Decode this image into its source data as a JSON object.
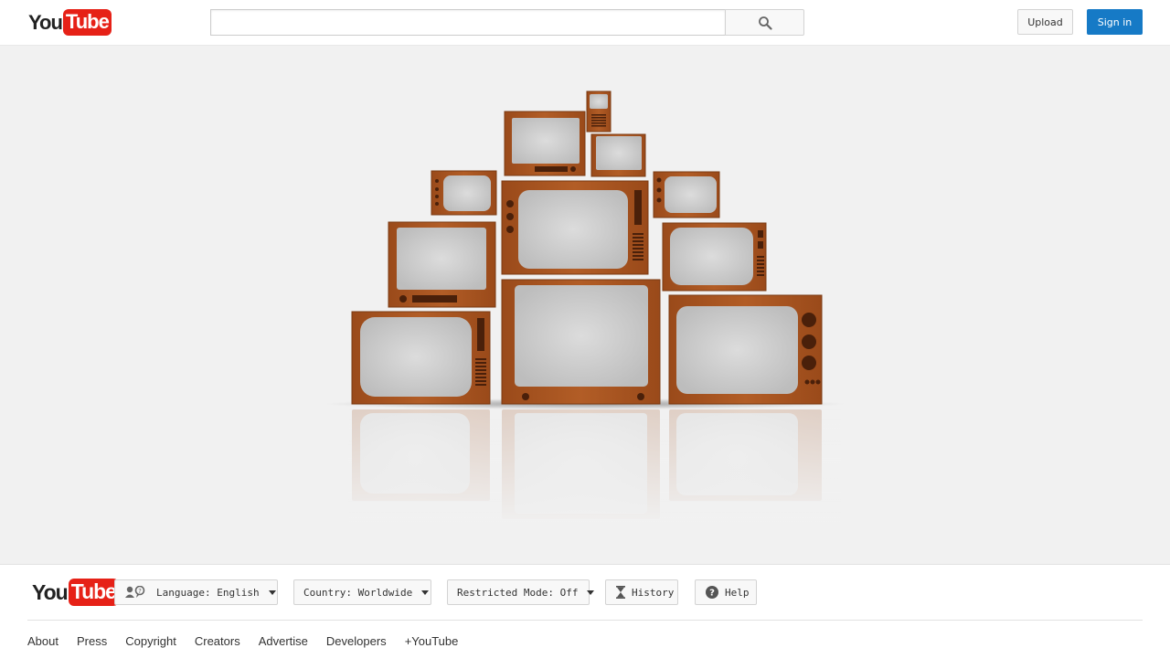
{
  "header": {
    "logo": {
      "you": "You",
      "tube": "Tube"
    },
    "search": {
      "placeholder": "",
      "value": "",
      "button_icon": "search-icon"
    },
    "upload_label": "Upload",
    "signin_label": "Sign in"
  },
  "illustration": {
    "subject": "stack of wooden vintage television sets with static screens"
  },
  "footer": {
    "logo": {
      "you": "You",
      "tube": "Tube"
    },
    "language_label": "Language: English",
    "country_label": "Country: Worldwide",
    "restricted_label": "Restricted Mode: Off",
    "history_label": "History",
    "help_label": "Help",
    "links": [
      "About",
      "Press",
      "Copyright",
      "Creators",
      "Advertise",
      "Developers",
      "+YouTube"
    ]
  },
  "colors": {
    "brand_red": "#e62117",
    "signin_blue": "#167ac6",
    "wood": "#a0501e",
    "screen": "#d2d2d2",
    "background": "#f1f1f1"
  }
}
